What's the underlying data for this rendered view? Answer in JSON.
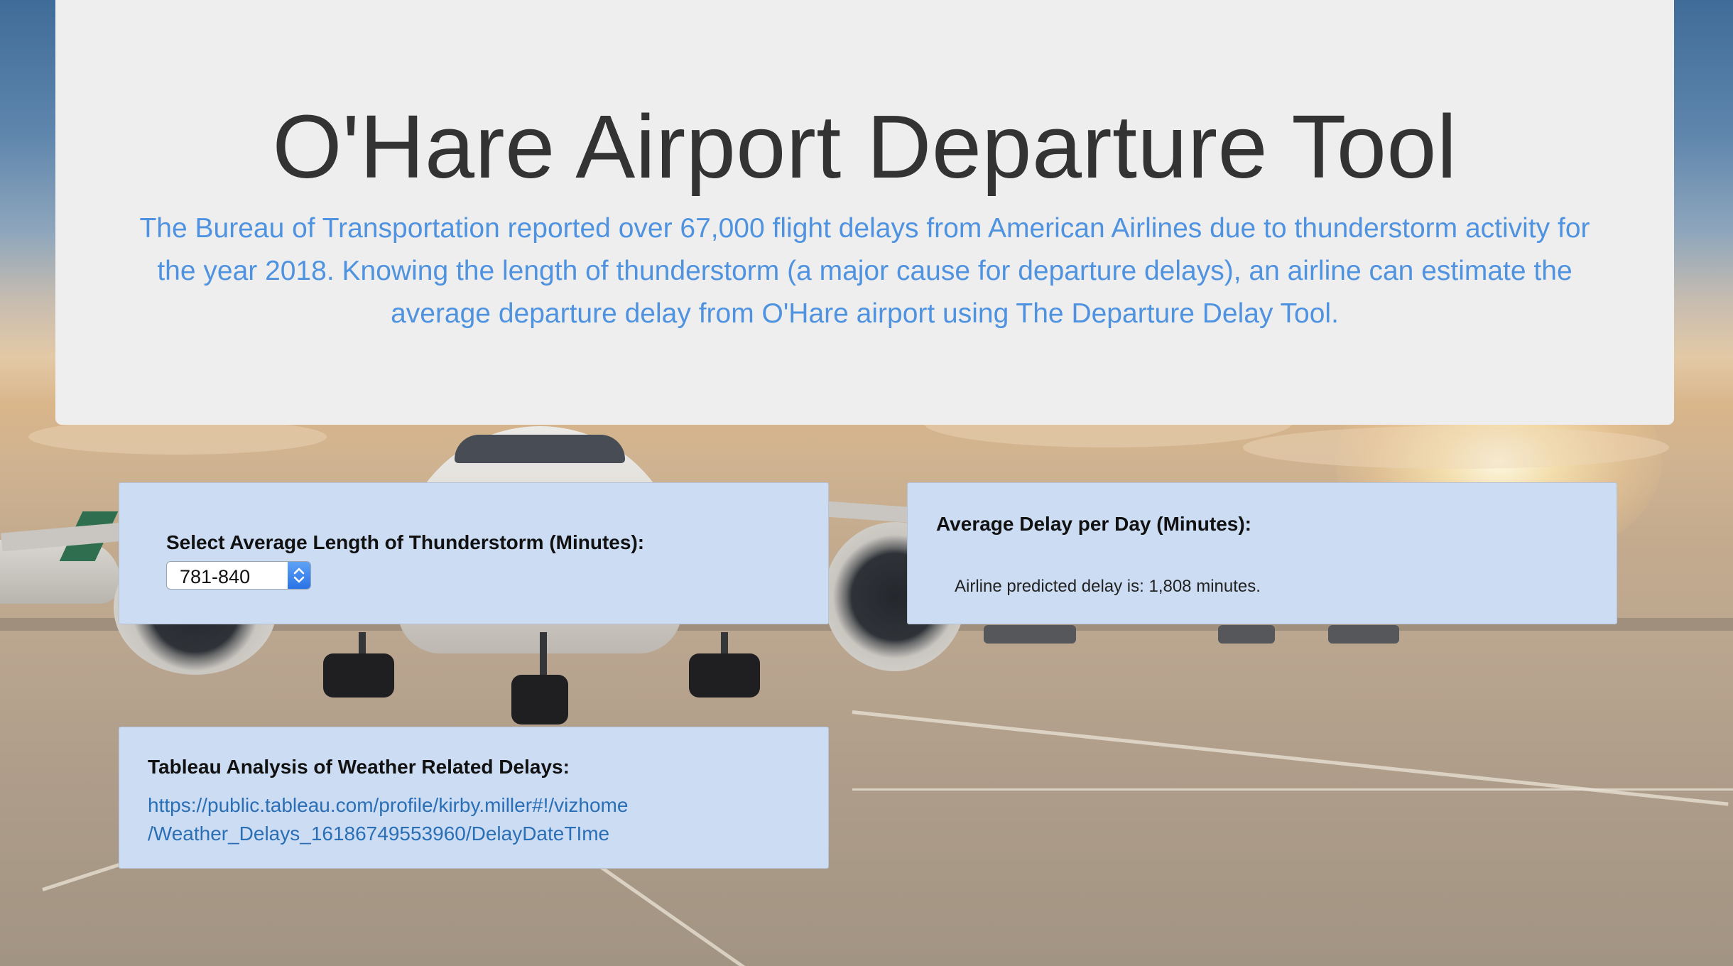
{
  "header": {
    "title": "O'Hare Airport Departure Tool",
    "description": "The Bureau of Transportation reported over 67,000 flight delays from American Airlines due to thunderstorm activity for the year 2018. Knowing the length of thunderstorm (a major cause for departure delays), an airline can estimate the average departure delay from O'Hare airport using The Departure Delay Tool."
  },
  "thunderstorm_card": {
    "label": "Select Average Length of Thunderstorm (Minutes):",
    "selected_value": "781-840"
  },
  "delay_card": {
    "title": "Average Delay per Day (Minutes):",
    "result_text": "Airline predicted delay is: 1,808 minutes."
  },
  "tableau_card": {
    "title": "Tableau Analysis of Weather Related Delays:",
    "link_line1": "https://public.tableau.com/profile/kirby.miller#!/vizhome",
    "link_line2": "/Weather_Delays_16186749553960/DelayDateTIme"
  },
  "colors": {
    "jumbotron_bg": "#eeeeee",
    "title_text": "#333333",
    "description_text": "#4f93e0",
    "card_bg": "#ccdcf3",
    "link": "#2a6fb6",
    "select_arrow": "#2a73e6"
  },
  "icons": {
    "select_arrow": "chevron-up-down-icon"
  }
}
